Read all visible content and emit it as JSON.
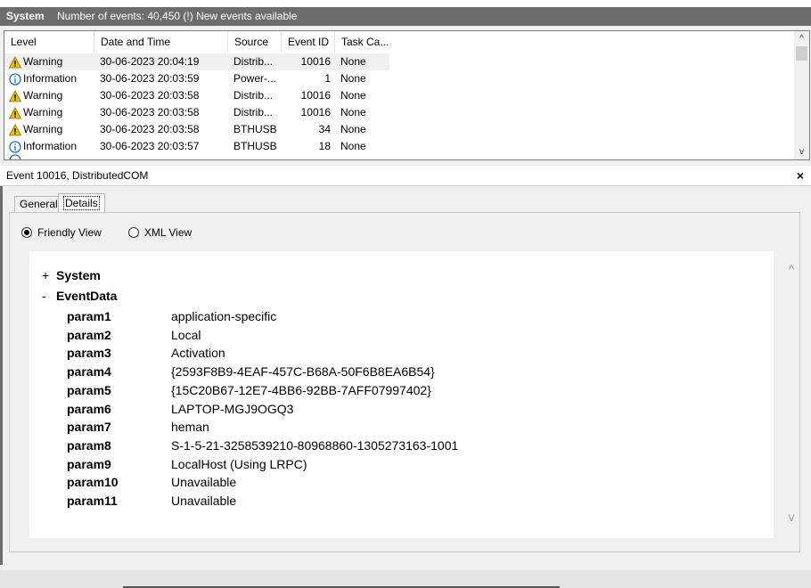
{
  "header": {
    "log_name": "System",
    "event_count": "Number of events: 40,450 (!) New events available"
  },
  "table": {
    "columns": [
      "Level",
      "Date and Time",
      "Source",
      "Event ID",
      "Task Ca..."
    ],
    "rows": [
      {
        "level": "Warning",
        "icon": "warning-icon",
        "datetime": "30-06-2023 20:04:19",
        "source": "Distrib...",
        "event_id": "10016",
        "task": "None"
      },
      {
        "level": "Information",
        "icon": "info-icon",
        "datetime": "30-06-2023 20:03:59",
        "source": "Power-...",
        "event_id": "1",
        "task": "None"
      },
      {
        "level": "Warning",
        "icon": "warning-icon",
        "datetime": "30-06-2023 20:03:58",
        "source": "Distrib...",
        "event_id": "10016",
        "task": "None"
      },
      {
        "level": "Warning",
        "icon": "warning-icon",
        "datetime": "30-06-2023 20:03:58",
        "source": "Distrib...",
        "event_id": "10016",
        "task": "None"
      },
      {
        "level": "Warning",
        "icon": "warning-icon",
        "datetime": "30-06-2023 20:03:58",
        "source": "BTHUSB",
        "event_id": "34",
        "task": "None"
      },
      {
        "level": "Information",
        "icon": "info-icon",
        "datetime": "30-06-2023 20:03:57",
        "source": "BTHUSB",
        "event_id": "18",
        "task": "None"
      }
    ]
  },
  "detail": {
    "title": "Event 10016, DistributedCOM",
    "close_label": "×",
    "tabs": {
      "general": "General",
      "details": "Details"
    },
    "views": {
      "friendly": "Friendly View",
      "xml": "XML View"
    },
    "tree": {
      "system_sign": "+",
      "system_label": "System",
      "eventdata_sign": "-",
      "eventdata_label": "EventData"
    },
    "params": [
      {
        "name": "param1",
        "value": "application-specific"
      },
      {
        "name": "param2",
        "value": "Local"
      },
      {
        "name": "param3",
        "value": "Activation"
      },
      {
        "name": "param4",
        "value": "{2593F8B9-4EAF-457C-B68A-50F6B8EA6B54}"
      },
      {
        "name": "param5",
        "value": "{15C20B67-12E7-4BB6-92BB-7AFF07997402}"
      },
      {
        "name": "param6",
        "value": "LAPTOP-MGJ9OGQ3"
      },
      {
        "name": "param7",
        "value": "heman"
      },
      {
        "name": "param8",
        "value": "S-1-5-21-3258539210-80968860-1305273163-1001"
      },
      {
        "name": "param9",
        "value": "LocalHost (Using LRPC)"
      },
      {
        "name": "param10",
        "value": "Unavailable"
      },
      {
        "name": "param11",
        "value": "Unavailable"
      }
    ]
  },
  "colors": {
    "header_bg": "#6d6d6d",
    "warning": "#f0c000",
    "info": "#1f6fd0"
  }
}
